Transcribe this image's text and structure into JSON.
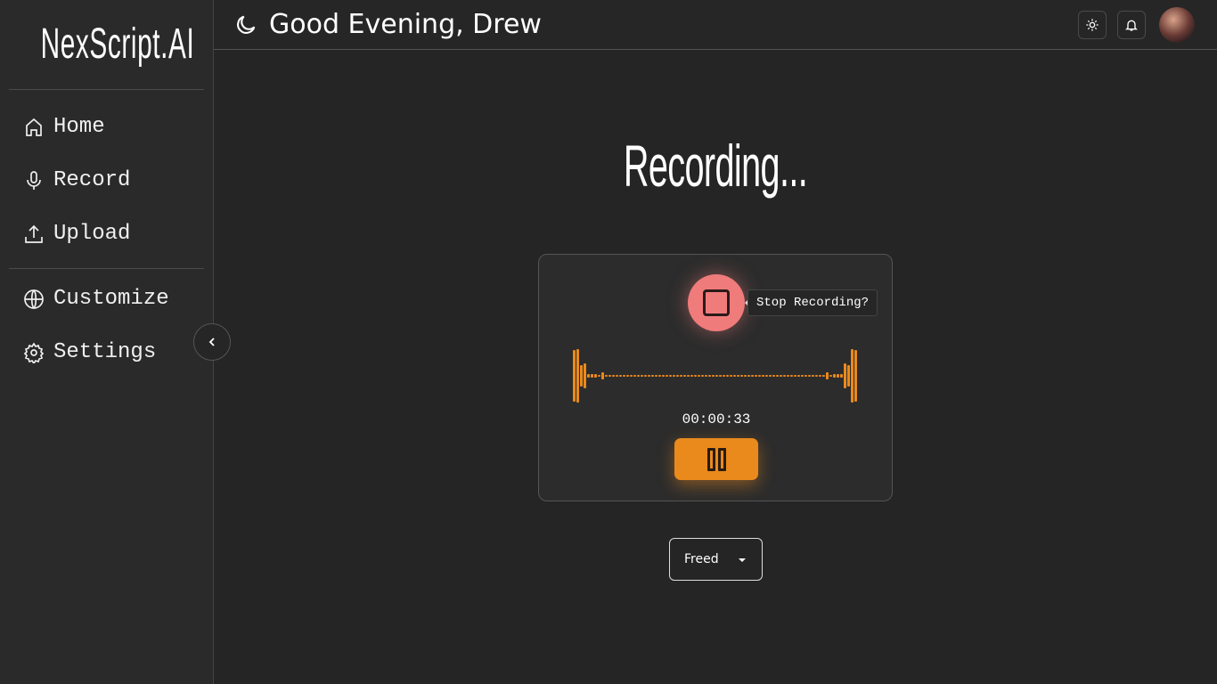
{
  "app": {
    "logo": "NexScript.AI"
  },
  "sidebar": {
    "items": [
      {
        "label": "Home",
        "icon": "home-icon"
      },
      {
        "label": "Record",
        "icon": "microphone-icon"
      },
      {
        "label": "Upload",
        "icon": "upload-icon"
      },
      {
        "label": "Customize",
        "icon": "globe-icon"
      },
      {
        "label": "Settings",
        "icon": "gear-icon"
      }
    ]
  },
  "header": {
    "greeting": "Good Evening, Drew"
  },
  "main": {
    "title": "Recording...",
    "stop_tooltip": "Stop Recording?",
    "timer": "00:00:33",
    "voice_select": "Freed"
  },
  "colors": {
    "accent": "#ea8a1c",
    "stop": "#f07b7b"
  }
}
